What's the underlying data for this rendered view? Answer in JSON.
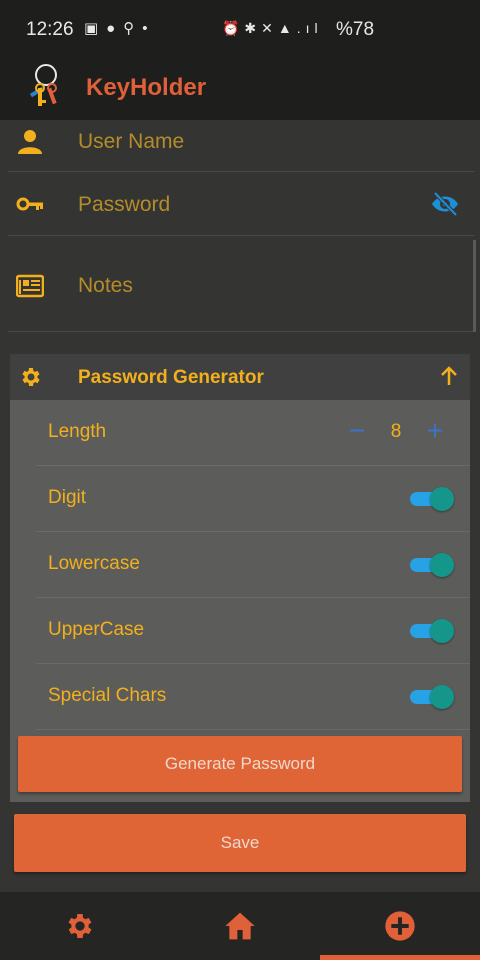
{
  "status_bar": {
    "time": "12:26",
    "battery": "%78"
  },
  "app": {
    "title": "KeyHolder"
  },
  "form": {
    "username_placeholder": "User Name",
    "password_placeholder": "Password",
    "notes_placeholder": "Notes"
  },
  "generator": {
    "title": "Password Generator",
    "length_label": "Length",
    "length_value": "8",
    "options": [
      {
        "label": "Digit",
        "enabled": true
      },
      {
        "label": "Lowercase",
        "enabled": true
      },
      {
        "label": "UpperCase",
        "enabled": true
      },
      {
        "label": "Special Chars",
        "enabled": true
      }
    ],
    "generate_label": "Generate Password"
  },
  "actions": {
    "save_label": "Save"
  },
  "bottom_nav": {
    "items": [
      "settings-icon",
      "home-icon",
      "add-icon"
    ],
    "active": "add-icon"
  },
  "colors": {
    "accent": "#e0603a",
    "label": "#f2b01c",
    "toggle_track": "#27a2e4",
    "toggle_thumb": "#15968a"
  }
}
